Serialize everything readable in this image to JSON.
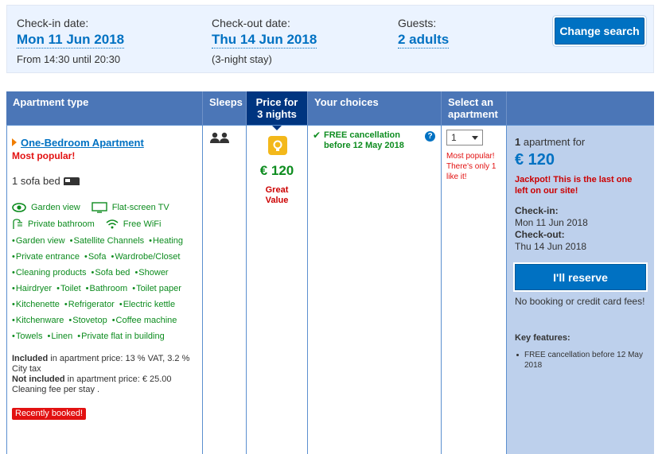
{
  "search": {
    "checkin_label": "Check-in date:",
    "checkin_value": "Mon 11 Jun 2018",
    "checkin_sub": "From 14:30 until 20:30",
    "checkout_label": "Check-out date:",
    "checkout_value": "Thu 14 Jun 2018",
    "checkout_sub": "(3-night stay)",
    "guests_label": "Guests:",
    "guests_value": "2 adults",
    "change_button": "Change search"
  },
  "table": {
    "headers": {
      "apartment_type": "Apartment type",
      "sleeps": "Sleeps",
      "price_line1": "Price for",
      "price_line2": "3 nights",
      "choices": "Your choices",
      "select_line1": "Select an",
      "select_line2": "apartment"
    },
    "row": {
      "name": "One-Bedroom Apartment",
      "popular": "Most popular!",
      "bed": "1 sofa bed",
      "facilities_top": [
        "Garden view",
        "Flat-screen TV",
        "Private bathroom",
        "Free WiFi"
      ],
      "facilities": [
        [
          "Garden view",
          "Satellite Channels",
          "Heating"
        ],
        [
          "Private entrance",
          "Sofa",
          "Wardrobe/Closet"
        ],
        [
          "Cleaning products",
          "Sofa bed",
          "Shower"
        ],
        [
          "Hairdryer",
          "Toilet",
          "Bathroom",
          "Toilet paper"
        ],
        [
          "Kitchenette",
          "Refrigerator",
          "Electric kettle"
        ],
        [
          "Kitchenware",
          "Stovetop",
          "Coffee machine"
        ],
        [
          "Towels",
          "Linen",
          "Private flat in building"
        ]
      ],
      "included_label": "Included",
      "included_text": " in apartment price: 13 % VAT, 3.2 % City tax",
      "not_included_label": "Not included",
      "not_included_text": " in apartment price: € 25.00 Cleaning fee per stay .",
      "recently_booked": "Recently booked!",
      "sleeps_icon": "two-people-icon",
      "price": "€ 120",
      "great_value": "Great Value",
      "choice": "FREE cancellation before 12 May 2018",
      "select_value": "1",
      "select_note": "Most popular! There's only 1 like it!"
    }
  },
  "summary": {
    "count_bold": "1",
    "count_text": " apartment for",
    "price": "€ 120",
    "jackpot": "Jackpot! This is the last one left on our site!",
    "checkin_label": "Check-in:",
    "checkin_value": "Mon 11 Jun 2018",
    "checkout_label": "Check-out:",
    "checkout_value": "Thu 14 Jun 2018",
    "reserve_button": "I'll reserve",
    "no_fees": "No booking or credit card fees!",
    "key_features_title": "Key features:",
    "key_feature_1": "FREE cancellation before 12 May 2018"
  },
  "colors": {
    "brand_blue": "#0071c2",
    "header_blue": "#4b76b7",
    "active_header": "#003580",
    "green": "#0d8c1f",
    "red": "#e21111"
  }
}
